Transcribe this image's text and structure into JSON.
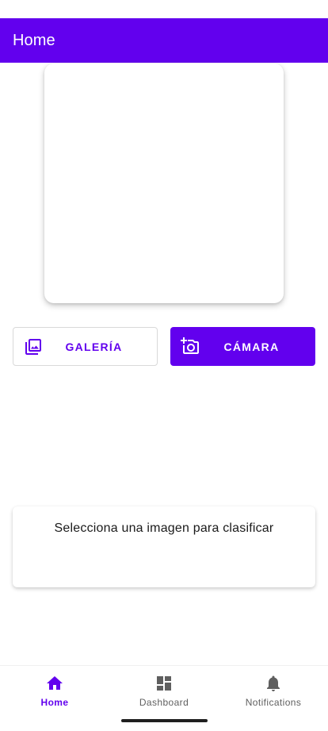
{
  "app_bar": {
    "title": "Home"
  },
  "actions": {
    "gallery_label": "GALERÍA",
    "camera_label": "CÁMARA",
    "gallery_icon": "photo-library-icon",
    "camera_icon": "add-a-photo-icon"
  },
  "result": {
    "text": "Selecciona una imagen para clasificar"
  },
  "bottom_nav": {
    "items": [
      {
        "label": "Home",
        "icon": "home-icon",
        "active": true
      },
      {
        "label": "Dashboard",
        "icon": "dashboard-icon",
        "active": false
      },
      {
        "label": "Notifications",
        "icon": "bell-icon",
        "active": false
      }
    ]
  },
  "colors": {
    "primary": "#6200ee",
    "active_nav": "#6200ee",
    "inactive_nav": "#5f5f5f"
  }
}
